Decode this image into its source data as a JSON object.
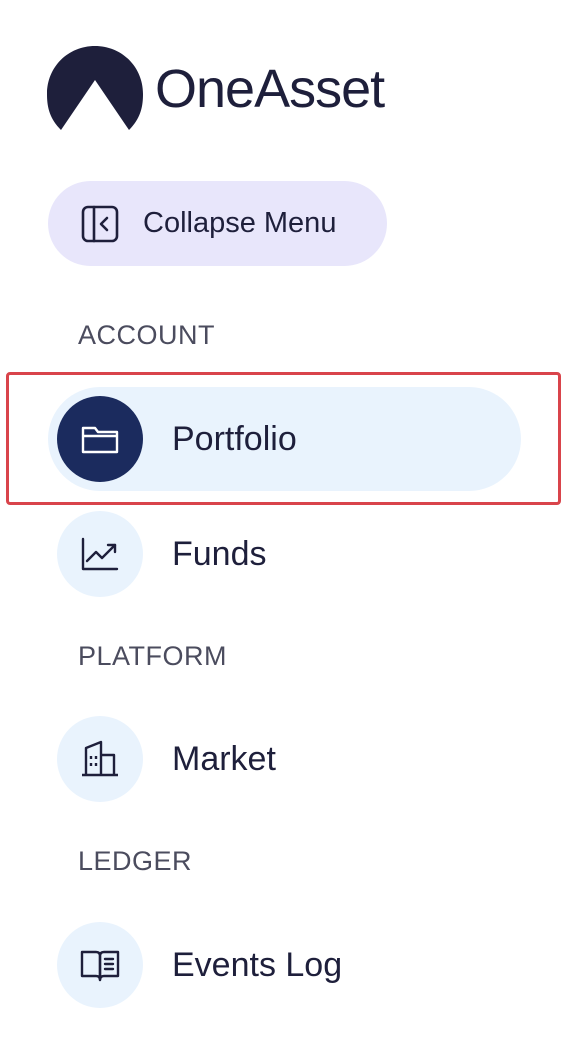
{
  "brand": {
    "name": "OneAsset",
    "color": "#1e1f3b"
  },
  "collapse": {
    "label": "Collapse Menu",
    "icon": "sidebar-collapse-icon",
    "bg": "#e8e6fb"
  },
  "sections": {
    "account": "ACCOUNT",
    "platform": "PLATFORM",
    "ledger": "LEDGER"
  },
  "nav": {
    "portfolio": {
      "label": "Portfolio",
      "icon": "folder-icon",
      "active": true
    },
    "funds": {
      "label": "Funds",
      "icon": "trend-chart-icon",
      "active": false
    },
    "market": {
      "label": "Market",
      "icon": "building-icon",
      "active": false
    },
    "events_log": {
      "label": "Events Log",
      "icon": "book-icon",
      "active": false
    }
  },
  "colors": {
    "active_bg": "#e9f3fd",
    "active_circle": "#1b2b5e",
    "highlight": "#d9444b",
    "section_text": "#4b4c5e"
  }
}
